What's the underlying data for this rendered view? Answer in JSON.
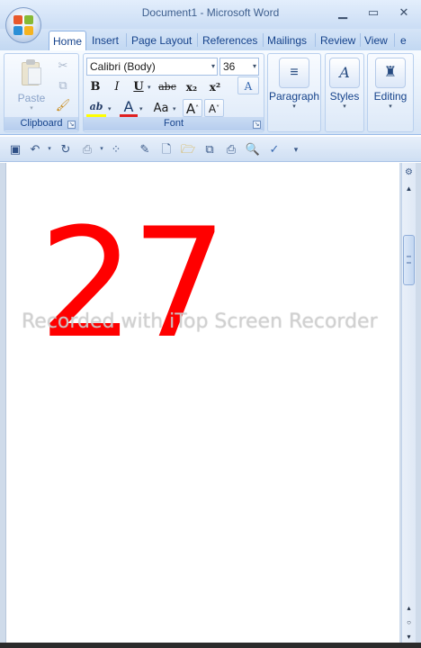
{
  "window": {
    "title": "Document1 - Microsoft Word",
    "minimize": "▁",
    "maximize": "▭",
    "close": "✕"
  },
  "tabs": [
    {
      "label": "Home",
      "active": true
    },
    {
      "label": "Insert"
    },
    {
      "label": "Page Layout"
    },
    {
      "label": "References"
    },
    {
      "label": "Mailings"
    },
    {
      "label": "Review"
    },
    {
      "label": "View"
    },
    {
      "label": "e"
    }
  ],
  "ribbon": {
    "clipboard": {
      "label": "Clipboard",
      "paste_label": "Paste",
      "cut_icon": "✂",
      "copy_icon": "⧉",
      "format_painter_icon": "🖌"
    },
    "font": {
      "label": "Font",
      "font_name": "Calibri (Body)",
      "font_size": "36",
      "bold": "B",
      "italic": "I",
      "underline": "U",
      "strikethrough": "abc",
      "subscript": "x₂",
      "superscript": "x²",
      "clear_format": "A",
      "highlight": "ab",
      "font_color": "A",
      "change_case": "Aa",
      "grow": "A",
      "shrink": "A",
      "font_color_hex": "#e02020",
      "highlight_hex": "#ffff00"
    },
    "paragraph": {
      "label": "Paragraph",
      "icon": "≡"
    },
    "styles": {
      "label": "Styles",
      "icon": "A"
    },
    "editing": {
      "label": "Editing",
      "icon": "♜"
    }
  },
  "qat": {
    "save_icon": "💾",
    "undo_icon": "↶",
    "redo_icon": "↻",
    "more": "▾"
  },
  "document": {
    "content": "27",
    "content_color": "#ff0000"
  },
  "watermark": "Recorded with iTop Screen Recorder"
}
